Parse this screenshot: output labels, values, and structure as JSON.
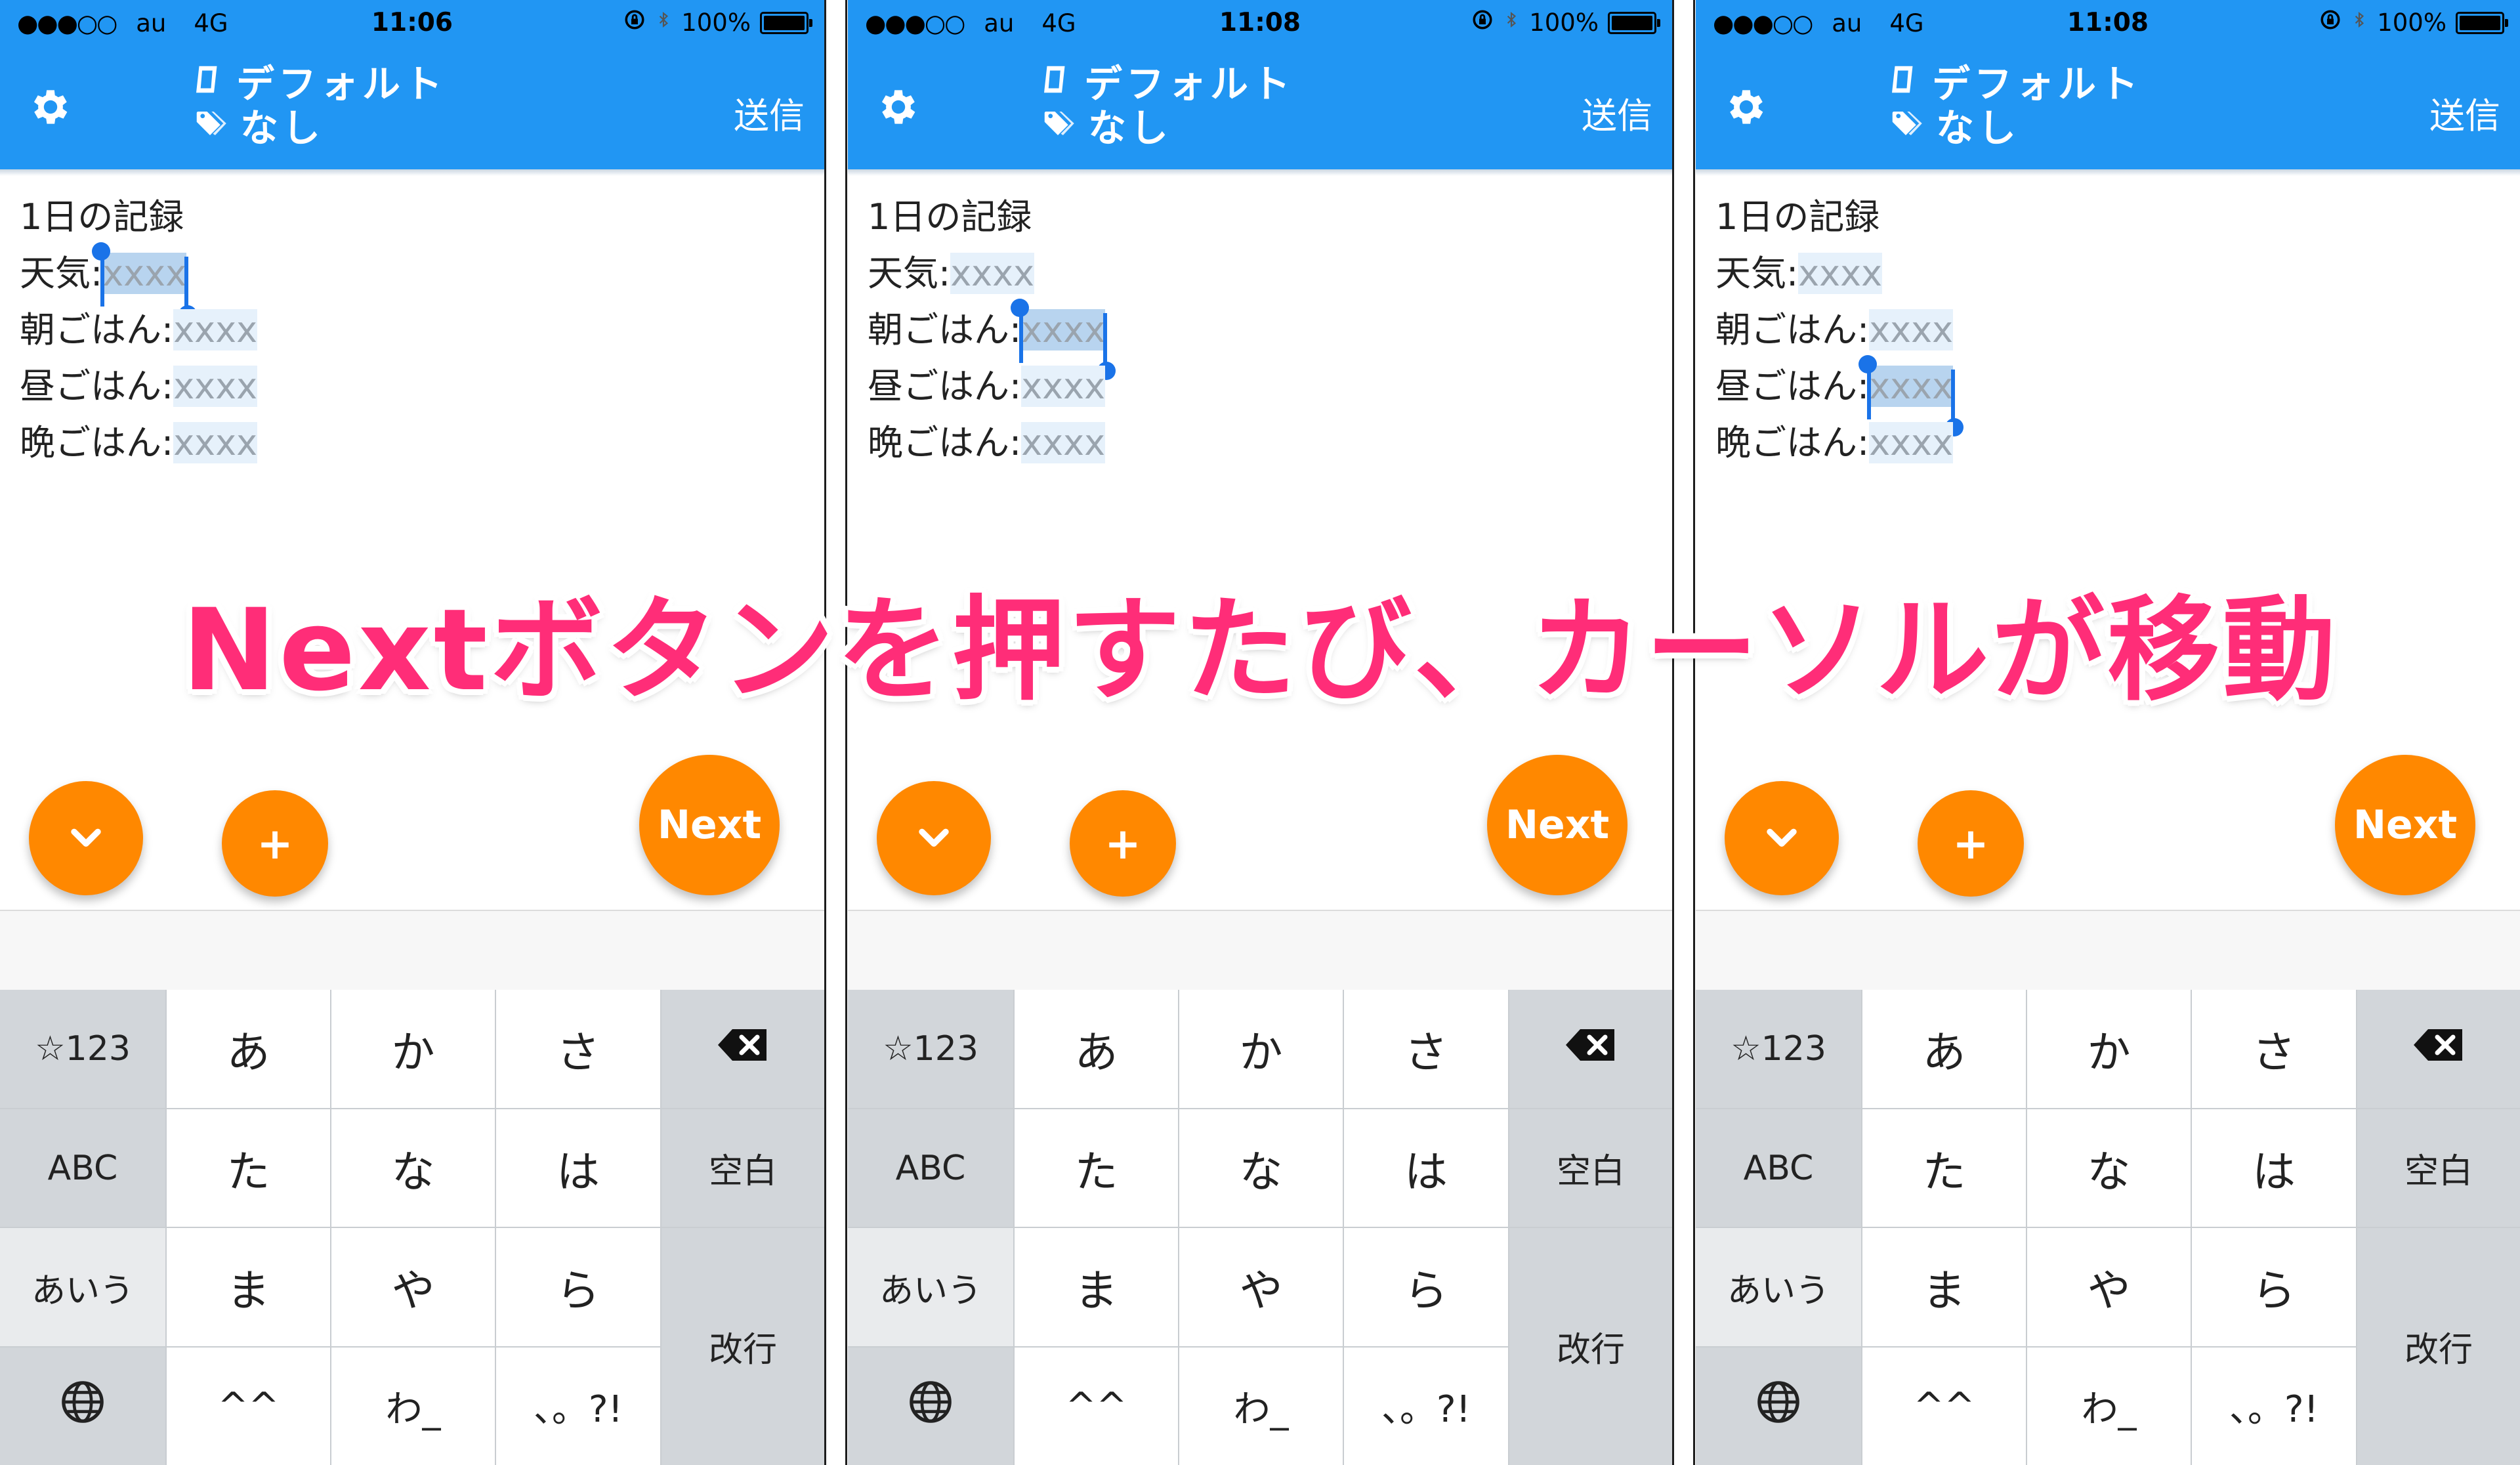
{
  "caption": "Nextボタンを押すたび、カーソルが移動",
  "status": {
    "signal": "●●●○○",
    "carrier": "au",
    "network": "4G",
    "battery_text": "100%"
  },
  "header": {
    "notebook": "デフォルト",
    "tag": "なし",
    "send_label": "送信"
  },
  "editor": {
    "title_line": "1日の記録",
    "fields": [
      "天気:",
      "朝ごはん:",
      "昼ごはん:",
      "晩ごはん:"
    ],
    "placeholder": "xxxx"
  },
  "panels": [
    {
      "time": "11:06",
      "selected_field": "天気:"
    },
    {
      "time": "11:08",
      "selected_field": "朝ごはん:"
    },
    {
      "time": "11:08",
      "selected_field": "昼ごはん:"
    }
  ],
  "buttons": {
    "next_label": "Next",
    "plus_label": "+"
  },
  "keyboard": {
    "left_column": [
      "☆123",
      "ABC",
      "あいう"
    ],
    "main_rows": [
      [
        "あ",
        "か",
        "さ"
      ],
      [
        "た",
        "な",
        "は"
      ],
      [
        "ま",
        "や",
        "ら"
      ],
      [
        "^^",
        "わ_",
        "、。?!"
      ]
    ],
    "space_label": "空白",
    "return_label": "改行"
  },
  "colors": {
    "header_blue": "#2196f3",
    "fab_orange": "#ff8800",
    "caption_pink": "#ff2d78",
    "selection_blue": "#1a73e8"
  },
  "icons": [
    "gear-icon",
    "notebook-icon",
    "tag-icon",
    "orientation-lock-icon",
    "bluetooth-icon",
    "battery-icon",
    "chevron-down-icon",
    "plus-icon",
    "backspace-icon",
    "globe-icon"
  ]
}
